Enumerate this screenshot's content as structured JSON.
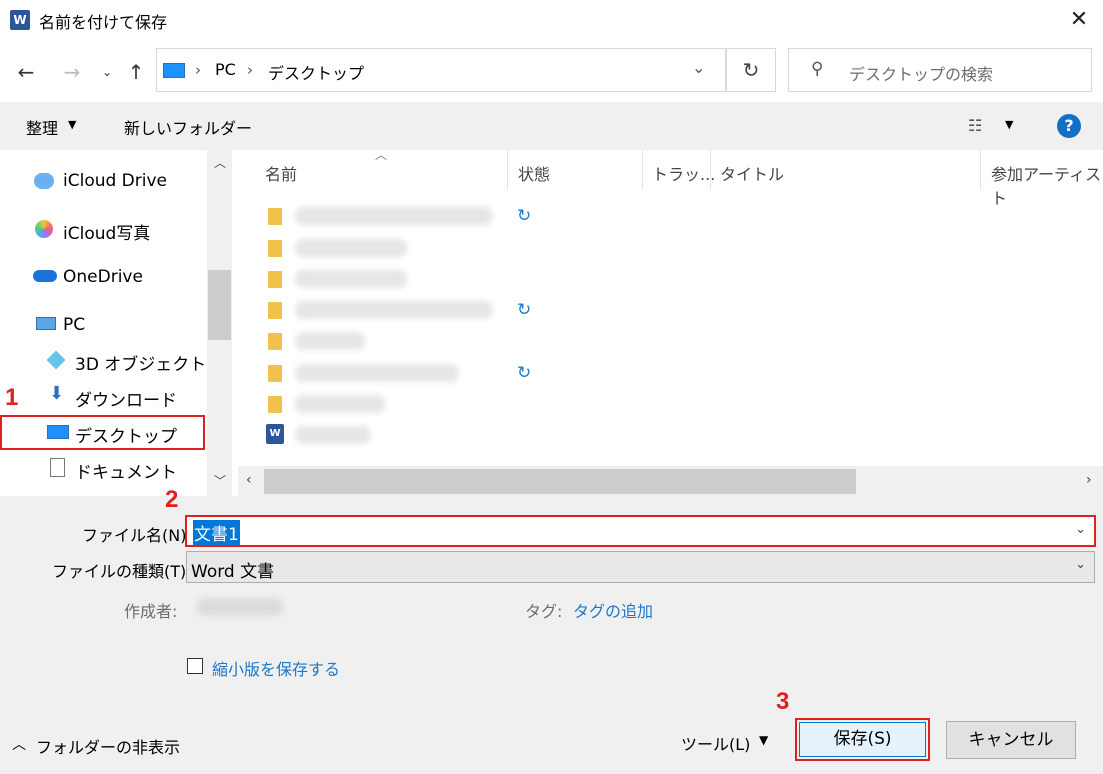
{
  "window": {
    "title": "名前を付けて保存",
    "app_icon_letter": "W"
  },
  "address": {
    "items": [
      "PC",
      "デスクトップ"
    ]
  },
  "search": {
    "placeholder": "デスクトップの検索"
  },
  "toolbar": {
    "organize": "整理",
    "new_folder": "新しいフォルダー"
  },
  "nav": {
    "items": [
      {
        "label": "iCloud Drive",
        "icon": "icloud-icon"
      },
      {
        "label": "iCloud写真",
        "icon": "photos-icon"
      },
      {
        "label": "OneDrive",
        "icon": "onedrive-icon"
      },
      {
        "label": "PC",
        "icon": "pc-icon"
      },
      {
        "label": "3D オブジェクト",
        "icon": "3d-objects-icon"
      },
      {
        "label": "ダウンロード",
        "icon": "download-icon"
      },
      {
        "label": "デスクトップ",
        "icon": "desktop-icon"
      },
      {
        "label": "ドキュメント",
        "icon": "document-icon"
      }
    ]
  },
  "columns": [
    "名前",
    "状態",
    "トラッ...",
    "タイトル",
    "参加アーティスト"
  ],
  "files": [
    {
      "type": "folder",
      "sync": true
    },
    {
      "type": "folder",
      "sync": false
    },
    {
      "type": "folder",
      "sync": false
    },
    {
      "type": "folder",
      "sync": true
    },
    {
      "type": "folder",
      "sync": false
    },
    {
      "type": "folder",
      "sync": true
    },
    {
      "type": "folder",
      "sync": false
    },
    {
      "type": "word",
      "sync": false
    }
  ],
  "form": {
    "filename_label": "ファイル名(N):",
    "filename_value": "文書1",
    "filetype_label": "ファイルの種類(T):",
    "filetype_value": "Word 文書",
    "author_label": "作成者:",
    "tag_label": "タグ:",
    "tag_link": "タグの追加",
    "thumbnail_label": "縮小版を保存する"
  },
  "footer": {
    "hide_folders": "フォルダーの非表示",
    "tools": "ツール(L)",
    "save": "保存(S)",
    "cancel": "キャンセル"
  },
  "annotations": [
    "1",
    "2",
    "3"
  ],
  "colors": {
    "accent": "#0078d7",
    "highlight_red": "#e0201f",
    "link": "#1e78c8"
  }
}
